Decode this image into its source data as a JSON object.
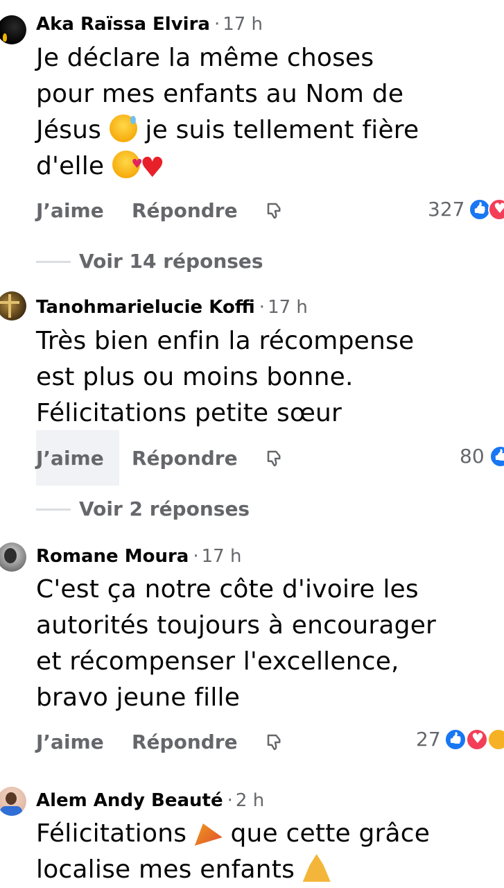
{
  "comments": [
    {
      "author": "Aka Raïssa Elvira",
      "time": "17 h",
      "text_l1": "Je déclare la même  choses",
      "text_l2": "pour mes enfants au Nom de",
      "text_l3a": "Jésus ",
      "text_l3b": " je suis tellement fière",
      "text_l4": "d'elle ",
      "emoji_1": "grinning-sweat-emoji",
      "emoji_2": "smiling-hearts-emoji",
      "emoji_3": "red-heart-emoji",
      "like_label": "J’aime",
      "reply_label": "Répondre",
      "reaction_count": "327",
      "see_replies": "Voir 14 réponses"
    },
    {
      "author": "Tanohmarielucie Koffi",
      "time": "17 h",
      "text_l1": "Très bien enfin la récompense",
      "text_l2": "est plus ou moins bonne.",
      "text_l3": "Félicitations petite sœur",
      "like_label": "J’aime",
      "reply_label": "Répondre",
      "reaction_count": "80",
      "see_replies": "Voir 2 réponses"
    },
    {
      "author": "Romane Moura",
      "time": "17 h",
      "text_l1": "C'est ça notre côte d'ivoire les",
      "text_l2": "autorités toujours à encourager",
      "text_l3": "et récompenser l'excellence,",
      "text_l4": "bravo jeune fille",
      "like_label": "J’aime",
      "reply_label": "Répondre",
      "reaction_count": "27"
    },
    {
      "author": "Alem Andy Beauté",
      "time": "2 h",
      "text_l1a": "Félicitations ",
      "text_l1b": " que cette grâce",
      "text_l2": "localise mes enfants ",
      "emoji_1": "party-popper-emoji",
      "emoji_2": "folded-hands-emoji"
    }
  ],
  "separator": "·",
  "colors": {
    "like_blue": "#1877f2",
    "love_red": "#f33e58",
    "secondary_text": "#65676b"
  },
  "icons": {
    "dislike": "thumbs-down-icon"
  }
}
